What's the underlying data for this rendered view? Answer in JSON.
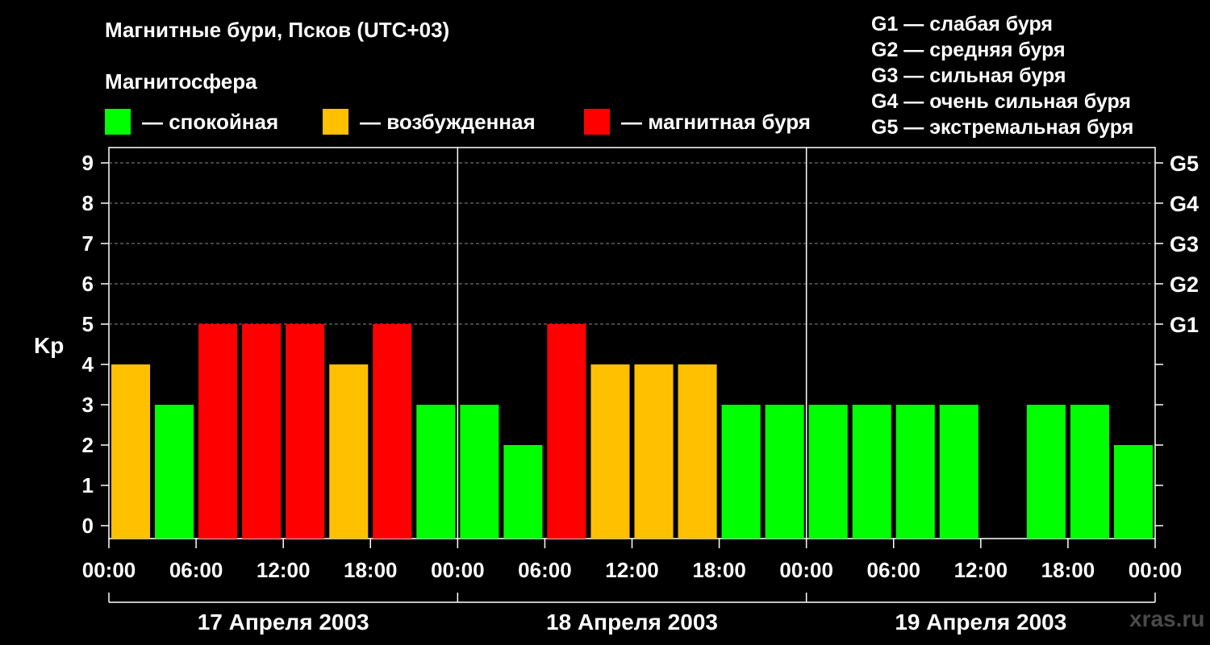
{
  "header": {
    "title": "Магнитные бури, Псков (UTC+03)",
    "subtitle": "Магнитосфера"
  },
  "legend": [
    {
      "label": "— спокойная",
      "color": "#00ff00"
    },
    {
      "label": "— возбужденная",
      "color": "#ffc000"
    },
    {
      "label": "— магнитная буря",
      "color": "#ff0000"
    }
  ],
  "storm_scale": [
    "G1 — слабая буря",
    "G2 — средняя буря",
    "G3 — сильная буря",
    "G4 — очень сильная буря",
    "G5 — экстремальная буря"
  ],
  "watermark": "xras.ru",
  "chart_data": {
    "type": "bar",
    "title": "Магнитные бури, Псков (UTC+03)",
    "ylabel": "Kp",
    "ylim": [
      0,
      9
    ],
    "yticks": [
      "0",
      "1",
      "2",
      "3",
      "4",
      "5",
      "6",
      "7",
      "8",
      "9"
    ],
    "right_axis_labels": [
      {
        "kp": 5,
        "label": "G1"
      },
      {
        "kp": 6,
        "label": "G2"
      },
      {
        "kp": 7,
        "label": "G3"
      },
      {
        "kp": 8,
        "label": "G4"
      },
      {
        "kp": 9,
        "label": "G5"
      }
    ],
    "xtick_labels": [
      "00:00",
      "06:00",
      "12:00",
      "18:00",
      "00:00",
      "06:00",
      "12:00",
      "18:00",
      "00:00",
      "06:00",
      "12:00",
      "18:00",
      "00:00"
    ],
    "days": [
      "17 Апреля 2003",
      "18 Апреля 2003",
      "19 Апреля 2003"
    ],
    "interval_hours": 3,
    "values": [
      4,
      3,
      5,
      5,
      5,
      4,
      5,
      3,
      3,
      2,
      5,
      4,
      4,
      4,
      3,
      3,
      3,
      3,
      3,
      3,
      null,
      3,
      3,
      2
    ],
    "colors": {
      "quiet": "#00ff00",
      "active": "#ffc000",
      "storm": "#ff0000"
    },
    "grid": true
  }
}
